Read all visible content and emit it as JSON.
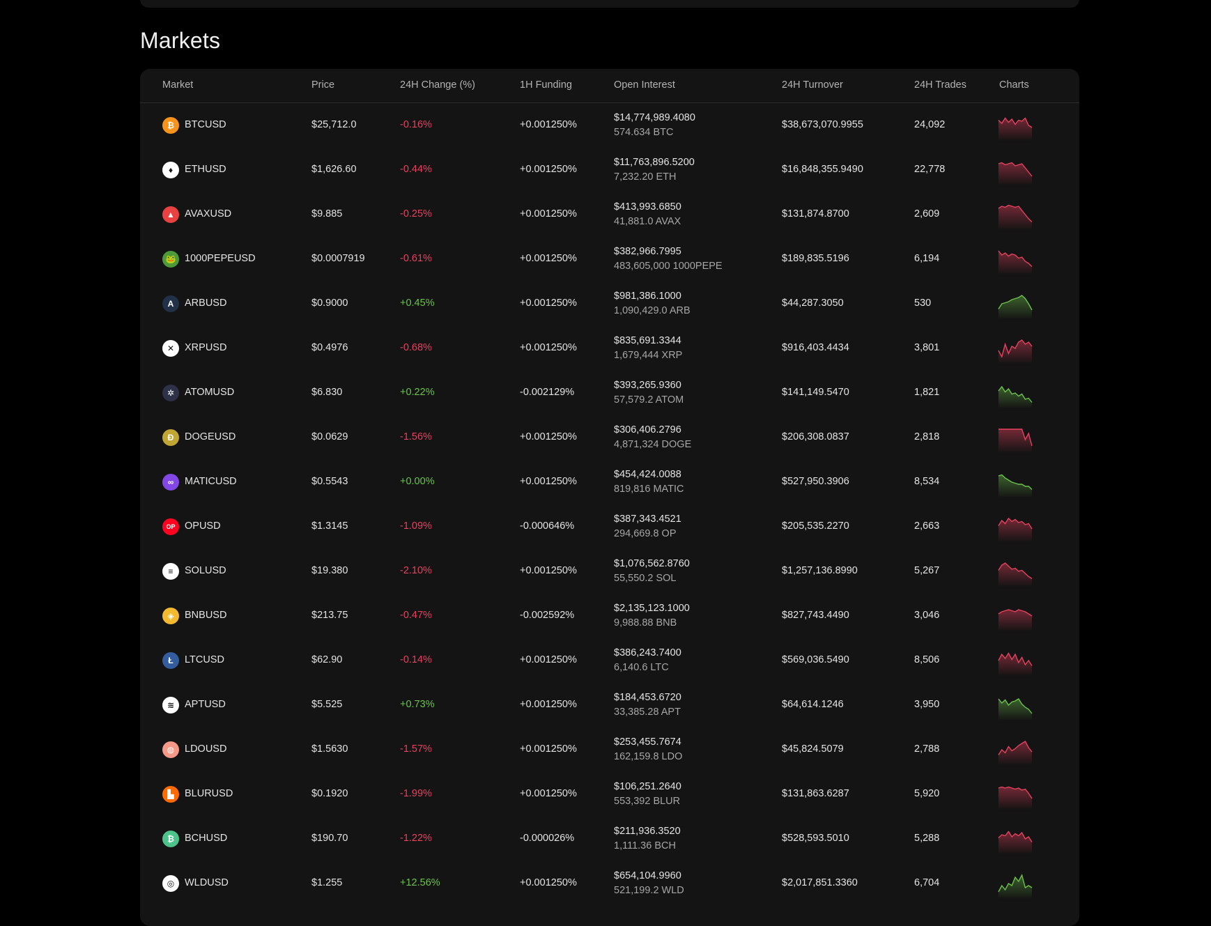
{
  "page": {
    "title": "Markets"
  },
  "table": {
    "headers": [
      "Market",
      "Price",
      "24H Change (%)",
      "1H Funding",
      "Open Interest",
      "24H Turnover",
      "24H Trades",
      "Charts"
    ],
    "rows": [
      {
        "symbol": "BTCUSD",
        "icon": "bitcoin-icon",
        "icon_color": "#f7931a",
        "icon_glyph": "₿",
        "price": "$25,712.0",
        "change": "-0.16%",
        "funding": "+0.001250%",
        "oi_usd": "$14,774,989.4080",
        "oi_coin": "574.634 BTC",
        "turnover": "$38,673,070.9955",
        "trades": "24,092",
        "trend": "down",
        "spark": [
          5,
          8,
          3,
          7,
          4,
          9,
          5,
          6,
          3,
          10,
          12
        ]
      },
      {
        "symbol": "ETHUSD",
        "icon": "ethereum-icon",
        "icon_color": "#ffffff",
        "icon_glyph": "♦",
        "price": "$1,626.60",
        "change": "-0.44%",
        "funding": "+0.001250%",
        "oi_usd": "$11,763,896.5200",
        "oi_coin": "7,232.20 ETH",
        "turnover": "$16,848,355.9490",
        "trades": "22,778",
        "trend": "down",
        "spark": [
          4,
          3,
          5,
          4,
          3,
          6,
          5,
          4,
          8,
          12,
          16
        ]
      },
      {
        "symbol": "AVAXUSD",
        "icon": "avalanche-icon",
        "icon_color": "#e84142",
        "icon_glyph": "▲",
        "price": "$9.885",
        "change": "-0.25%",
        "funding": "+0.001250%",
        "oi_usd": "$413,993.6850",
        "oi_coin": "41,881.0 AVAX",
        "turnover": "$131,874.8700",
        "trades": "2,609",
        "trend": "down",
        "spark": [
          4,
          2,
          3,
          1,
          2,
          3,
          2,
          6,
          10,
          14,
          17
        ]
      },
      {
        "symbol": "1000PEPEUSD",
        "icon": "pepe-icon",
        "icon_color": "#4e9a3a",
        "icon_glyph": "🐸",
        "price": "$0.0007919",
        "change": "-0.61%",
        "funding": "+0.001250%",
        "oi_usd": "$382,966.7995",
        "oi_coin": "483,605,000 1000PEPE",
        "turnover": "$189,835.5196",
        "trades": "6,194",
        "trend": "down",
        "spark": [
          2,
          6,
          4,
          7,
          5,
          6,
          9,
          8,
          12,
          14,
          17
        ]
      },
      {
        "symbol": "ARBUSD",
        "icon": "arbitrum-icon",
        "icon_color": "#213147",
        "icon_glyph": "A",
        "price": "$0.9000",
        "change": "+0.45%",
        "funding": "+0.001250%",
        "oi_usd": "$981,386.1000",
        "oi_coin": "1,090,429.0 ARB",
        "turnover": "$44,287.3050",
        "trades": "530",
        "trend": "up",
        "spark": [
          15,
          10,
          9,
          8,
          6,
          5,
          4,
          2,
          5,
          10,
          16
        ]
      },
      {
        "symbol": "XRPUSD",
        "icon": "xrp-icon",
        "icon_color": "#ffffff",
        "icon_glyph": "✕",
        "price": "$0.4976",
        "change": "-0.68%",
        "funding": "+0.001250%",
        "oi_usd": "$835,691.3344",
        "oi_coin": "1,679,444 XRP",
        "turnover": "$916,403.4434",
        "trades": "3,801",
        "trend": "down",
        "spark": [
          12,
          18,
          6,
          15,
          8,
          10,
          4,
          2,
          6,
          4,
          8
        ]
      },
      {
        "symbol": "ATOMUSD",
        "icon": "cosmos-icon",
        "icon_color": "#2e3148",
        "icon_glyph": "✲",
        "price": "$6.830",
        "change": "+0.22%",
        "funding": "-0.002129%",
        "oi_usd": "$393,265.9360",
        "oi_coin": "57,579.2 ATOM",
        "turnover": "$141,149.5470",
        "trades": "1,821",
        "trend": "up",
        "spark": [
          8,
          4,
          9,
          6,
          11,
          10,
          13,
          11,
          16,
          15,
          19
        ]
      },
      {
        "symbol": "DOGEUSD",
        "icon": "dogecoin-icon",
        "icon_color": "#c2a633",
        "icon_glyph": "Ð",
        "price": "$0.0629",
        "change": "-1.56%",
        "funding": "+0.001250%",
        "oi_usd": "$306,406.2796",
        "oi_coin": "4,871,324 DOGE",
        "turnover": "$206,308.0837",
        "trades": "2,818",
        "trend": "down",
        "spark": [
          2,
          2,
          2,
          2,
          2,
          2,
          2,
          2,
          12,
          6,
          18
        ]
      },
      {
        "symbol": "MATICUSD",
        "icon": "polygon-icon",
        "icon_color": "#8247e5",
        "icon_glyph": "∞",
        "price": "$0.5543",
        "change": "+0.00%",
        "funding": "+0.001250%",
        "oi_usd": "$454,424.0088",
        "oi_coin": "819,816 MATIC",
        "turnover": "$527,950.3906",
        "trades": "8,534",
        "trend": "up",
        "spark": [
          4,
          3,
          6,
          8,
          10,
          11,
          12,
          12,
          14,
          14,
          17
        ]
      },
      {
        "symbol": "OPUSD",
        "icon": "optimism-icon",
        "icon_color": "#ff0420",
        "icon_glyph": "OP",
        "price": "$1.3145",
        "change": "-1.09%",
        "funding": "-0.000646%",
        "oi_usd": "$387,343.4521",
        "oi_coin": "294,669.8 OP",
        "turnover": "$205,535.2270",
        "trades": "2,663",
        "trend": "down",
        "spark": [
          9,
          4,
          7,
          2,
          5,
          3,
          6,
          5,
          8,
          7,
          12
        ]
      },
      {
        "symbol": "SOLUSD",
        "icon": "solana-icon",
        "icon_color": "#ffffff",
        "icon_glyph": "≡",
        "price": "$19.380",
        "change": "-2.10%",
        "funding": "+0.001250%",
        "oi_usd": "$1,076,562.8760",
        "oi_coin": "55,550.2 SOL",
        "turnover": "$1,257,136.8990",
        "trades": "5,267",
        "trend": "down",
        "spark": [
          9,
          4,
          2,
          5,
          8,
          7,
          10,
          9,
          12,
          15,
          17
        ]
      },
      {
        "symbol": "BNBUSD",
        "icon": "bnb-icon",
        "icon_color": "#f3ba2f",
        "icon_glyph": "◈",
        "price": "$213.75",
        "change": "-0.47%",
        "funding": "-0.002592%",
        "oi_usd": "$2,135,123.1000",
        "oi_coin": "9,988.88 BNB",
        "turnover": "$827,743.4490",
        "trades": "3,046",
        "trend": "down",
        "spark": [
          8,
          6,
          5,
          4,
          5,
          6,
          4,
          5,
          6,
          8,
          10
        ]
      },
      {
        "symbol": "LTCUSD",
        "icon": "litecoin-icon",
        "icon_color": "#345d9d",
        "icon_glyph": "Ł",
        "price": "$62.90",
        "change": "-0.14%",
        "funding": "+0.001250%",
        "oi_usd": "$386,243.7400",
        "oi_coin": "6,140.6 LTC",
        "turnover": "$569,036.5490",
        "trades": "8,506",
        "trend": "down",
        "spark": [
          10,
          4,
          8,
          3,
          9,
          4,
          12,
          7,
          14,
          10,
          15
        ]
      },
      {
        "symbol": "APTUSD",
        "icon": "aptos-icon",
        "icon_color": "#ffffff",
        "icon_glyph": "≋",
        "price": "$5.525",
        "change": "+0.73%",
        "funding": "+0.001250%",
        "oi_usd": "$184,453.6720",
        "oi_coin": "33,385.28 APT",
        "turnover": "$64,614.1246",
        "trades": "3,950",
        "trend": "up",
        "spark": [
          4,
          8,
          5,
          10,
          7,
          6,
          4,
          9,
          12,
          14,
          18
        ]
      },
      {
        "symbol": "LDOUSD",
        "icon": "lido-icon",
        "icon_color": "#f69988",
        "icon_glyph": "◍",
        "price": "$1.5630",
        "change": "-1.57%",
        "funding": "+0.001250%",
        "oi_usd": "$253,455.7674",
        "oi_coin": "162,159.8 LDO",
        "turnover": "$45,824.5079",
        "trades": "2,788",
        "trend": "down",
        "spark": [
          15,
          10,
          13,
          7,
          11,
          9,
          6,
          4,
          2,
          8,
          12
        ]
      },
      {
        "symbol": "BLURUSD",
        "icon": "blur-icon",
        "icon_color": "#ff6b00",
        "icon_glyph": "▙",
        "price": "$0.1920",
        "change": "-1.99%",
        "funding": "+0.001250%",
        "oi_usd": "$106,251.2640",
        "oi_coin": "553,392 BLUR",
        "turnover": "$131,863.6287",
        "trades": "5,920",
        "trend": "down",
        "spark": [
          4,
          3,
          4,
          3,
          4,
          5,
          4,
          6,
          5,
          9,
          14
        ]
      },
      {
        "symbol": "BCHUSD",
        "icon": "bitcoin-cash-icon",
        "icon_color": "#4cc38a",
        "icon_glyph": "₿",
        "price": "$190.70",
        "change": "-1.22%",
        "funding": "-0.000026%",
        "oi_usd": "$211,936.3520",
        "oi_coin": "1,111.36 BCH",
        "turnover": "$528,593.5010",
        "trades": "5,288",
        "trend": "down",
        "spark": [
          9,
          6,
          7,
          3,
          8,
          5,
          7,
          4,
          10,
          8,
          13
        ]
      },
      {
        "symbol": "WLDUSD",
        "icon": "worldcoin-icon",
        "icon_color": "#ffffff",
        "icon_glyph": "◎",
        "price": "$1.255",
        "change": "+12.56%",
        "funding": "+0.001250%",
        "oi_usd": "$654,104.9960",
        "oi_coin": "521,199.2 WLD",
        "turnover": "$2,017,851.3360",
        "trades": "6,704",
        "trend": "up",
        "spark": [
          18,
          12,
          16,
          10,
          12,
          4,
          8,
          2,
          14,
          12,
          14
        ]
      }
    ]
  },
  "colors": {
    "negative": "#e8415f",
    "positive": "#6cc24a",
    "panel": "#141414",
    "background": "#000000"
  }
}
